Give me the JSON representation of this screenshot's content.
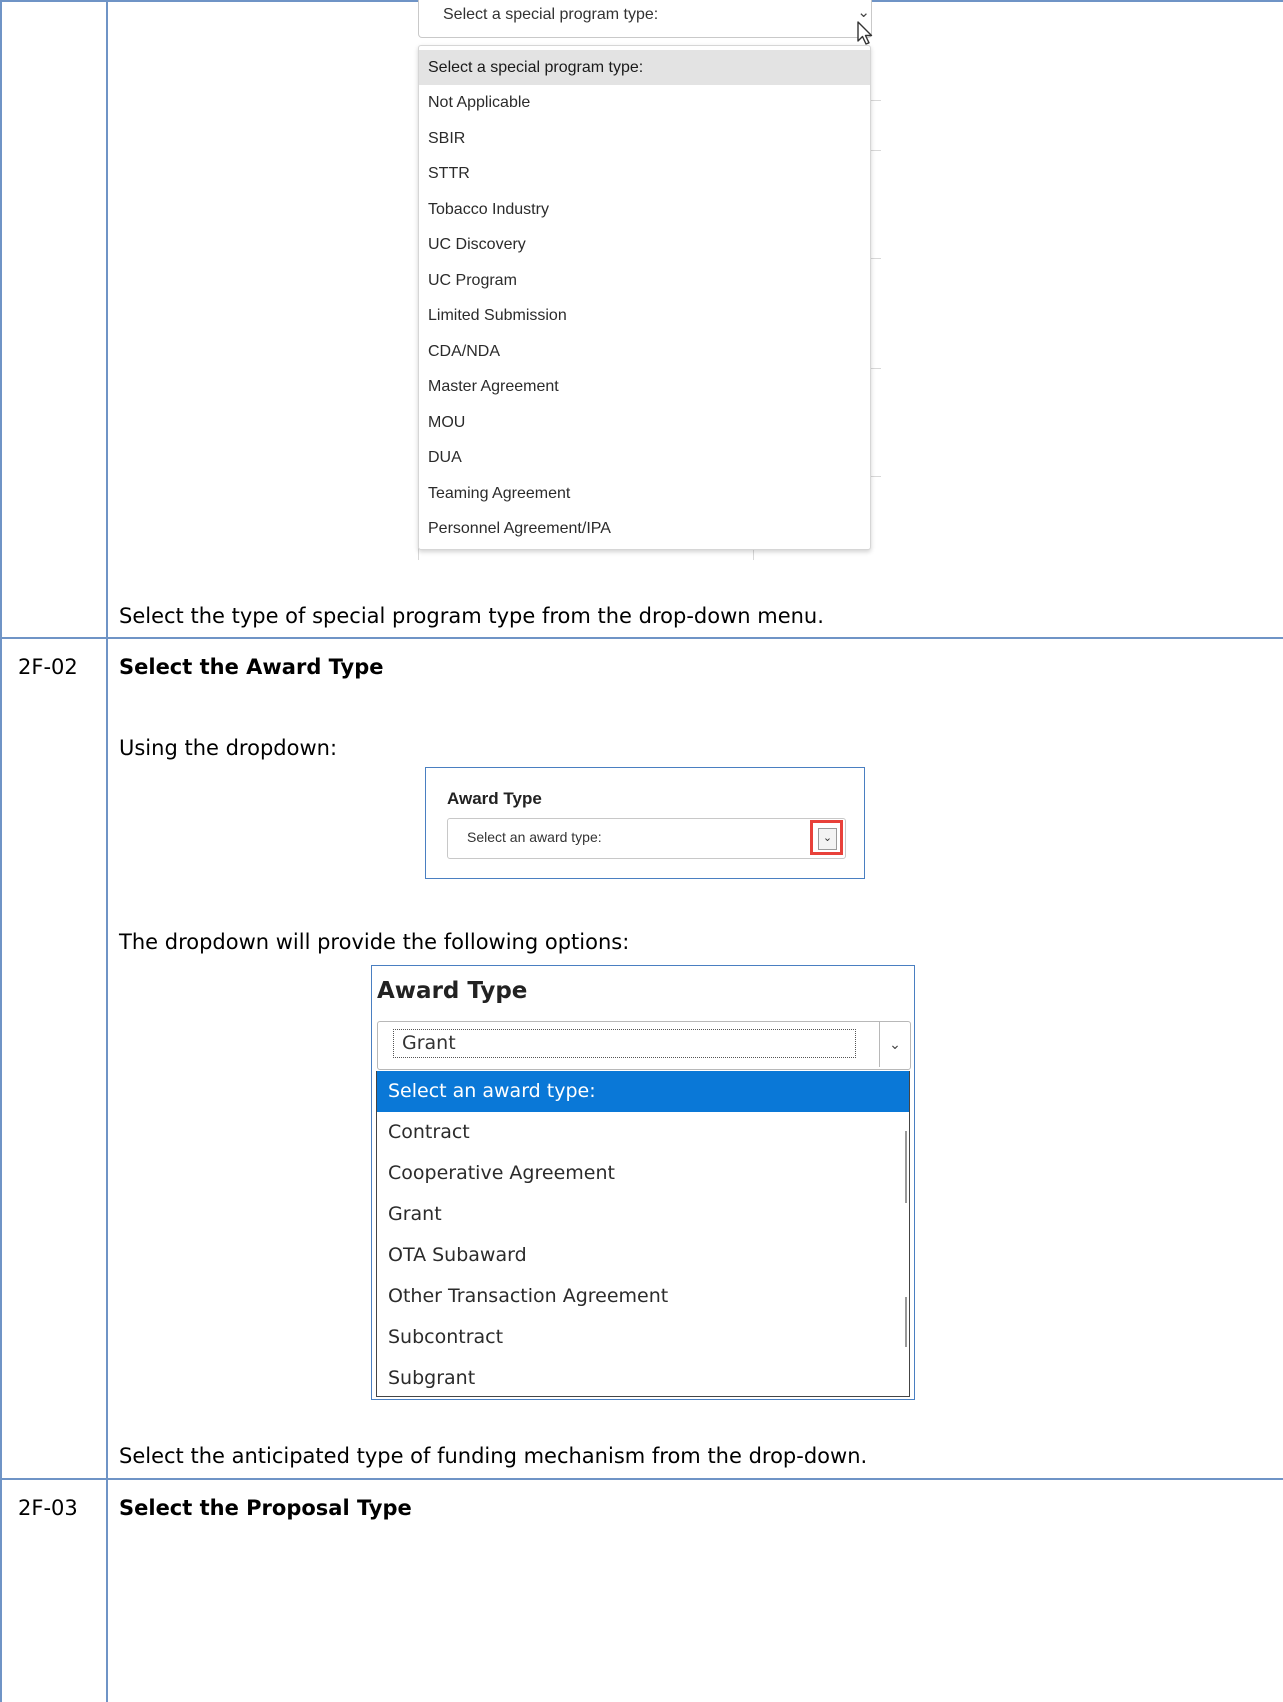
{
  "special_program": {
    "select_placeholder": "Select a special program type:",
    "options": [
      "Select a special program type:",
      "Not Applicable",
      "SBIR",
      "STTR",
      "Tobacco Industry",
      "UC Discovery",
      "UC Program",
      "Limited Submission",
      "CDA/NDA",
      "Master Agreement",
      "MOU",
      "DUA",
      "Teaming Agreement",
      "Personnel Agreement/IPA"
    ],
    "instruction": "Select the type of special program type from the drop-down menu."
  },
  "steps": [
    {
      "id": "2F-02",
      "title": "Select the Award Type",
      "intro": "Using the dropdown:",
      "options_intro": "The dropdown will provide the following options:",
      "instruction": "Select the anticipated type of funding mechanism from the drop-down."
    },
    {
      "id": "2F-03",
      "title": "Select the Proposal Type"
    }
  ],
  "award_type_select": {
    "label": "Award Type",
    "placeholder": "Select an award type:"
  },
  "award_type_expanded": {
    "label": "Award Type",
    "current_value": "Grant",
    "options": [
      "Select an award type:",
      "Contract",
      "Cooperative Agreement",
      "Grant",
      "OTA Subaward",
      "Other Transaction Agreement",
      "Subcontract",
      "Subgrant"
    ]
  },
  "colors": {
    "table_border": "#6f94c6",
    "highlight_box": "#e8413a",
    "selected_option": "#0a78d7"
  }
}
